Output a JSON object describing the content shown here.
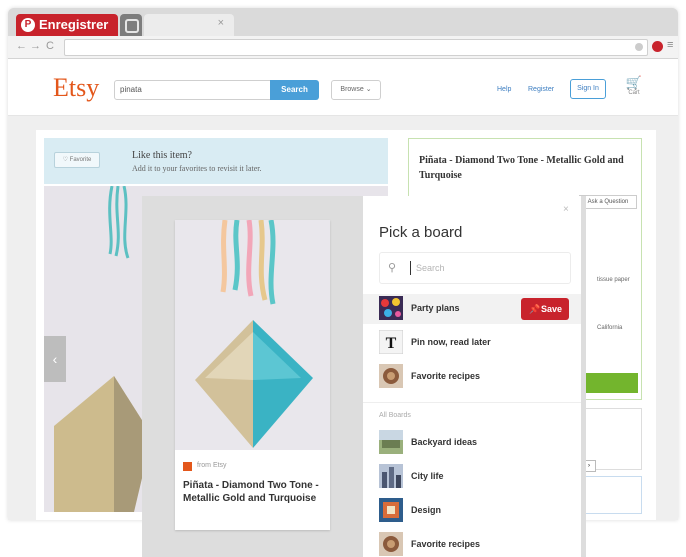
{
  "browser": {
    "pin_button_label": "Enregistrer",
    "tab_close": "×",
    "nav_back": "←",
    "nav_forward": "→",
    "reload": "C",
    "menu": "≡"
  },
  "etsy": {
    "logo": "Etsy",
    "search_value": "pinata",
    "search_button": "Search",
    "browse_label": "Browse",
    "help_link": "Help",
    "register_link": "Register",
    "signin_button": "Sign In",
    "cart_label": "Cart"
  },
  "listing": {
    "favorite_button": "♡ Favorite",
    "favorite_title": "Like this item?",
    "favorite_subtitle": "Add it to your favorites to revisit it later.",
    "info_title": "Piñata - Diamond Two Tone - Metallic Gold and Turquoise",
    "ask_question": "Ask a Question",
    "info_line_1": "tissue paper",
    "info_line_2": "California",
    "prev_arrow": "‹",
    "page_control": "›"
  },
  "pin_card": {
    "from_label": "from Etsy",
    "title": "Piñata - Diamond Two Tone - Metallic Gold and Turquoise"
  },
  "board_picker": {
    "title": "Pick a board",
    "close": "×",
    "search_placeholder": "Search",
    "save_button": "Save",
    "all_boards_label": "All Boards",
    "top_boards": [
      {
        "name": "Party plans",
        "thumb": "party",
        "active": true
      },
      {
        "name": "Pin now, read later",
        "thumb": "nyt",
        "active": false
      },
      {
        "name": "Favorite recipes",
        "thumb": "recipes",
        "active": false
      }
    ],
    "all_boards": [
      {
        "name": "Backyard ideas",
        "thumb": "backyard"
      },
      {
        "name": "City life",
        "thumb": "city"
      },
      {
        "name": "Design",
        "thumb": "design"
      },
      {
        "name": "Favorite recipes",
        "thumb": "recipes"
      }
    ]
  },
  "colors": {
    "pinterest_red": "#c8232c",
    "etsy_orange": "#e3571b",
    "etsy_blue": "#4a9fd8",
    "green": "#73b52d"
  }
}
